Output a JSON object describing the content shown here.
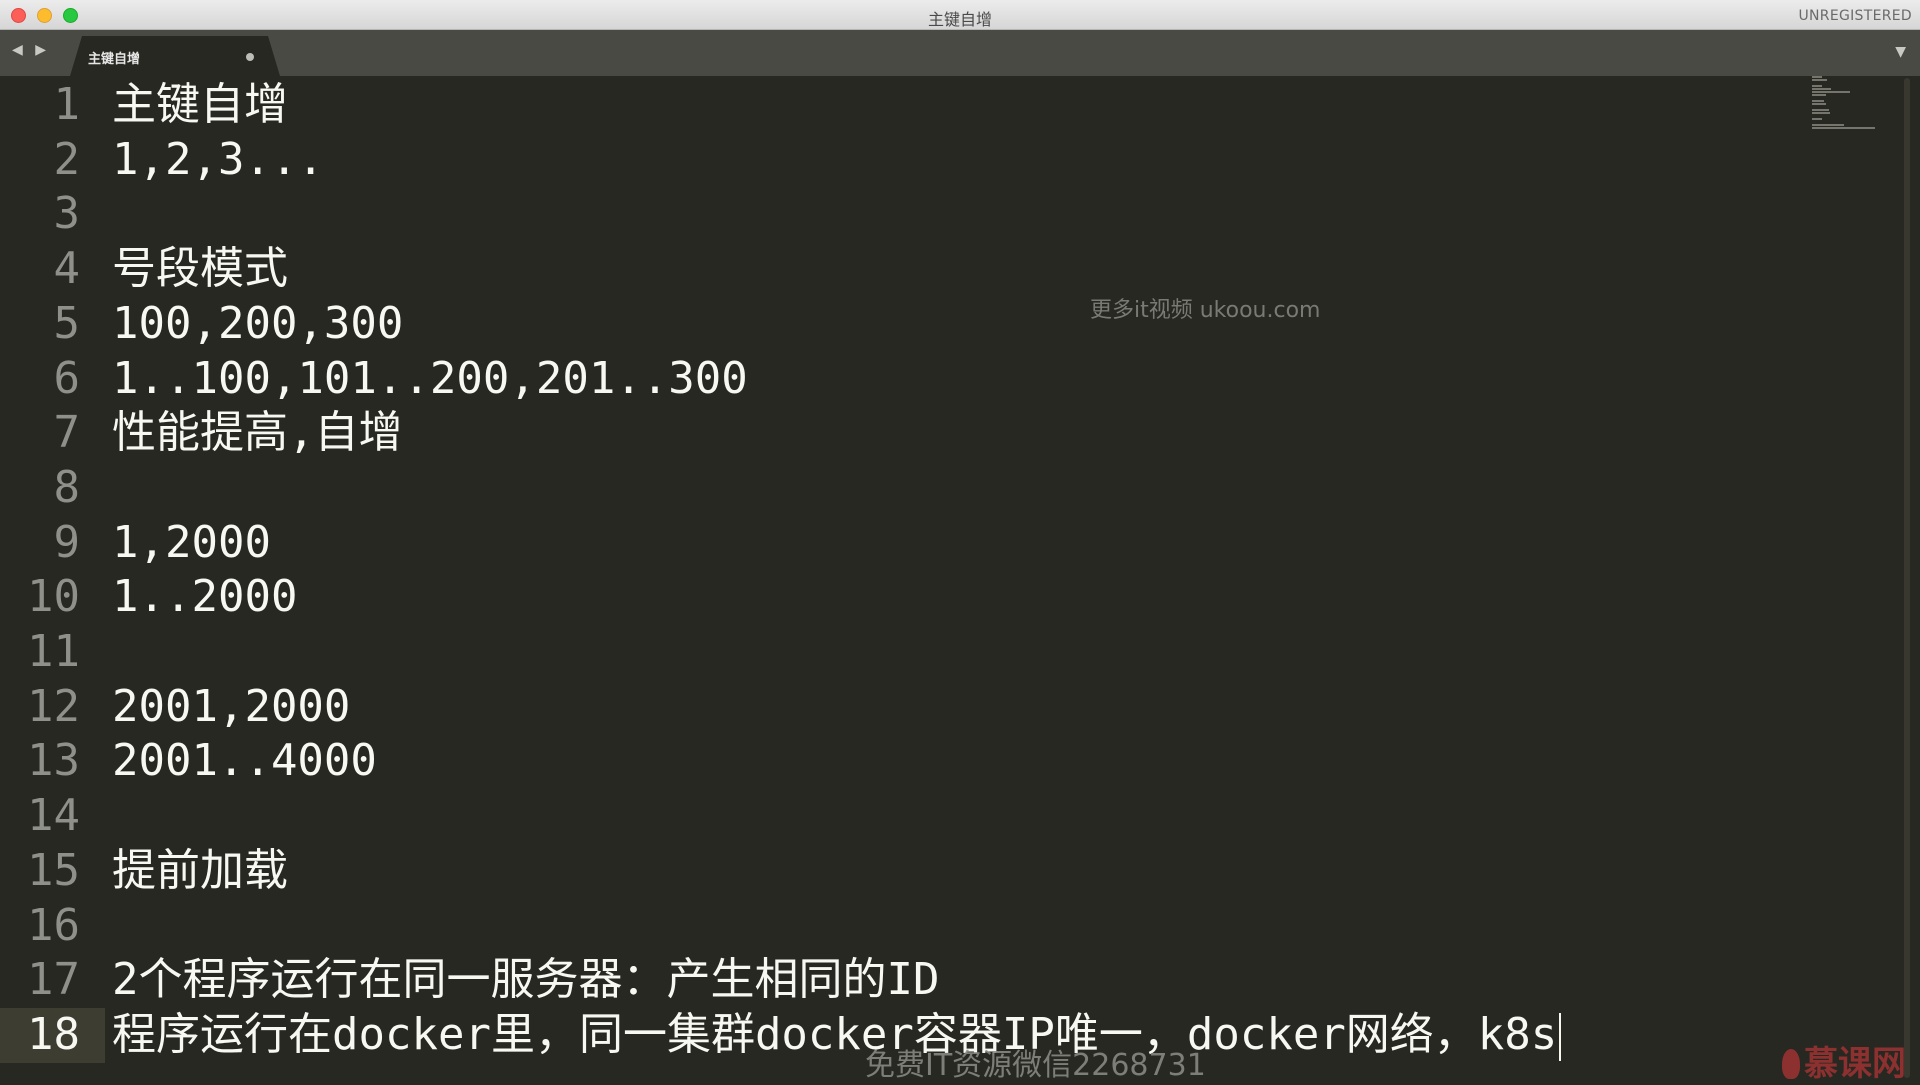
{
  "window": {
    "title": "主键自增",
    "status": "UNREGISTERED"
  },
  "tabbar": {
    "nav_arrows": "◀ ▶",
    "tab_label": "主键自增",
    "menu_icon": "▼"
  },
  "editor": {
    "line_numbers": [
      "1",
      "2",
      "3",
      "4",
      "5",
      "6",
      "7",
      "8",
      "9",
      "10",
      "11",
      "12",
      "13",
      "14",
      "15",
      "16",
      "17",
      "18"
    ],
    "lines": [
      "主键自增",
      "1,2,3...",
      "",
      "号段模式",
      "100,200,300",
      "1..100,101..200,201..300",
      "性能提高,自增",
      "",
      "1,2000",
      "1..2000",
      "",
      "2001,2000",
      "2001..4000",
      "",
      "提前加载",
      "",
      "2个程序运行在同一服务器：产生相同的ID",
      "程序运行在docker里，同一集群docker容器IP唯一，docker网络，k8s"
    ],
    "active_line": 18
  },
  "overlays": {
    "watermark": "更多it视频 ukoou.com",
    "subtitle": "免费IT资源微信2268731",
    "brand": "慕课网"
  }
}
